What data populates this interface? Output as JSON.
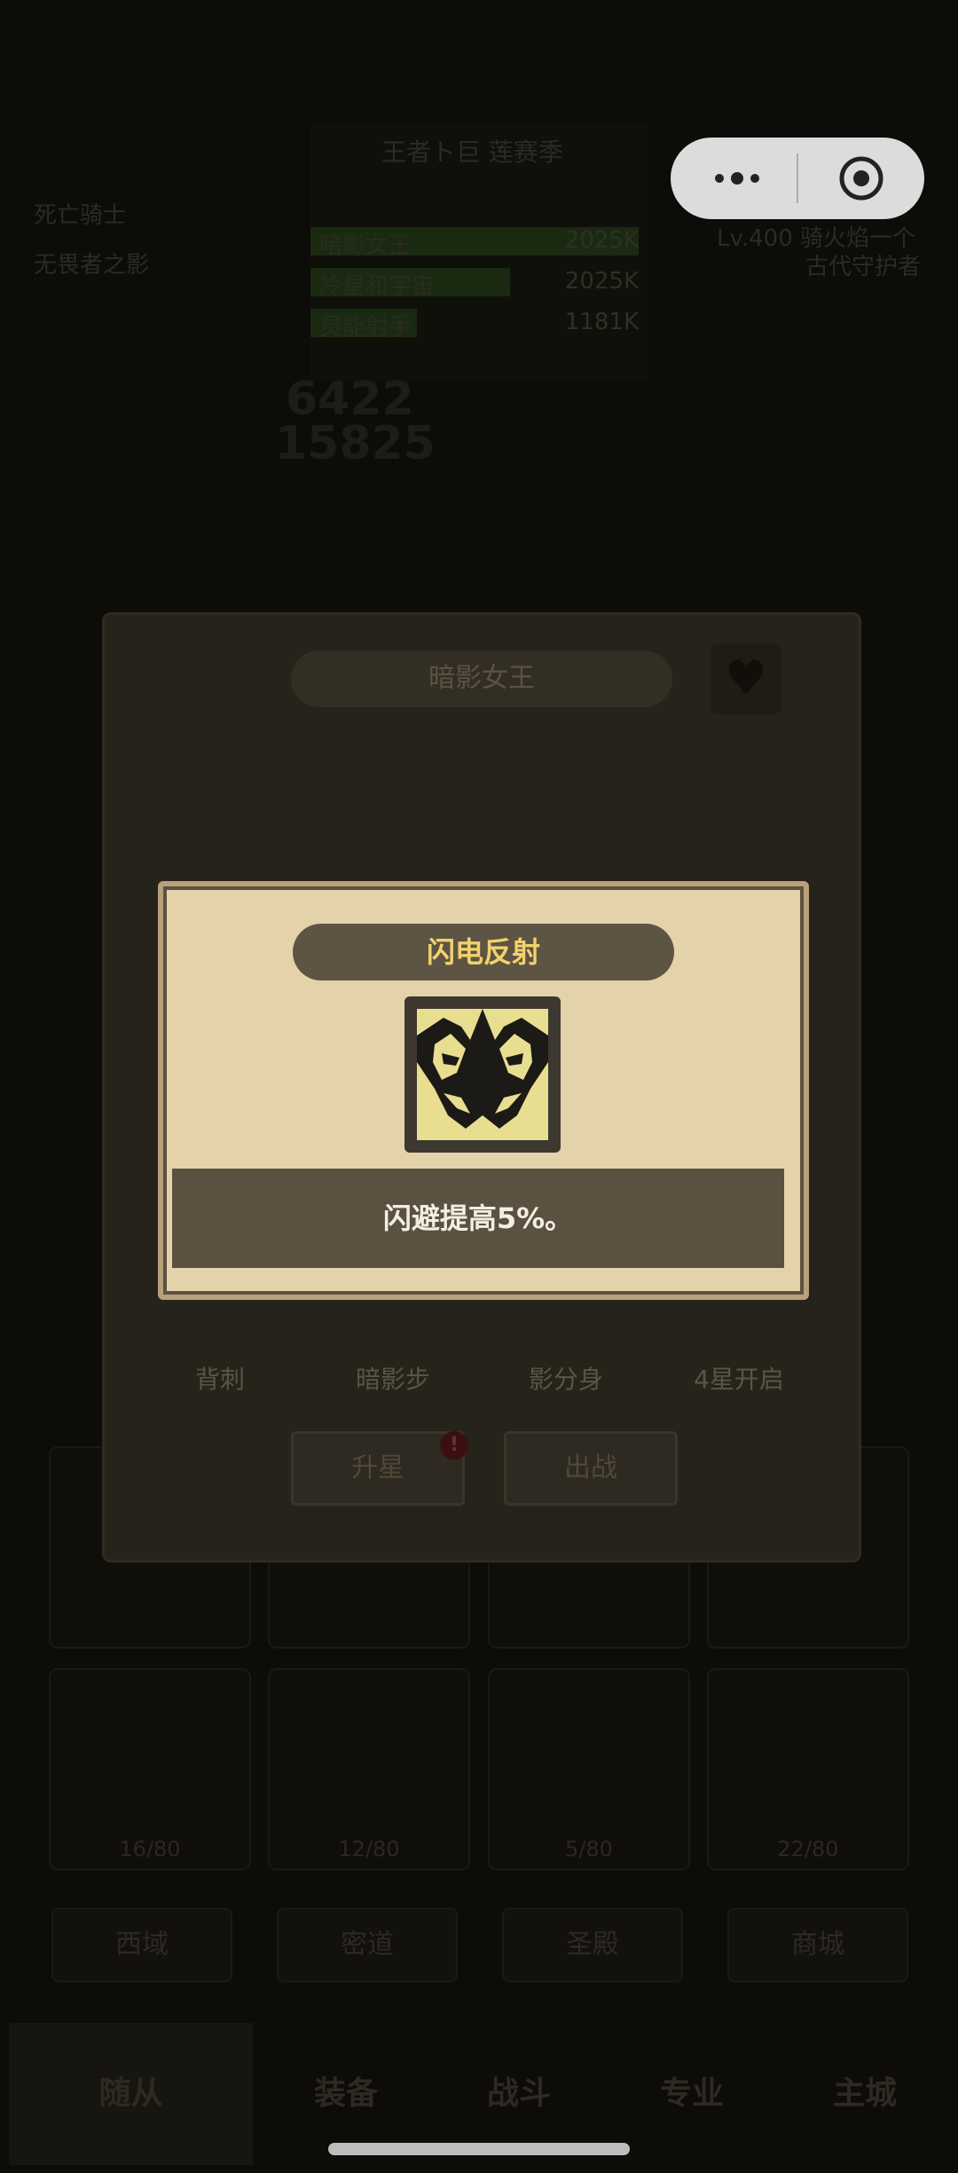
{
  "background": {
    "left_labels": [
      "死亡骑士",
      "无畏者之影"
    ],
    "ranking_title": "王者ト巨 莲赛季",
    "ranking_rows": [
      {
        "name": "暗影女王",
        "value": "2025K"
      },
      {
        "name": "冷星和宇宙",
        "value": "2025K"
      },
      {
        "name": "灵能射手",
        "value": "1181K"
      }
    ],
    "big_numbers": [
      "6422",
      "15825"
    ],
    "right_labels": [
      "Lv.400 骑火焰一个",
      "古代守护者"
    ],
    "slot_counts": [
      "16/80",
      "12/80",
      "5/80",
      "22/80"
    ],
    "tabs": [
      "西域",
      "密道",
      "圣殿",
      "商城"
    ],
    "nav": [
      "随从",
      "装备",
      "战斗",
      "专业",
      "主城"
    ]
  },
  "hero_card": {
    "title": "暗影女王",
    "heart_icon": "heart-icon",
    "skills": [
      "背刺",
      "暗影步",
      "影分身",
      "4星开启"
    ],
    "upgrade_button": "升星",
    "deploy_button": "出战",
    "badge": "!"
  },
  "popup": {
    "title": "闪电反射",
    "description": "闪避提高5%。",
    "icon": "twin-mask-icon"
  },
  "colors": {
    "popup_bg": "#e4d2ab",
    "title_text": "#f2d26c",
    "desc_band": "#5b5141"
  }
}
